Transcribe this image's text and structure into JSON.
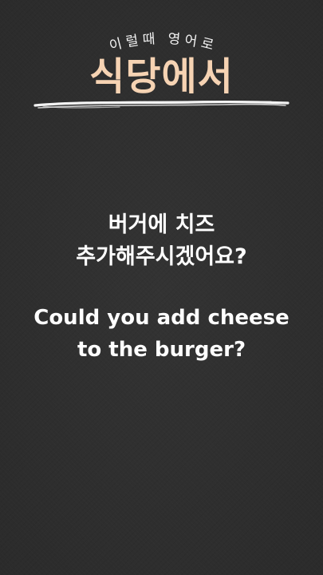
{
  "header": {
    "subtitle": "이럴때 영어로",
    "title": "식당에서"
  },
  "phrase": {
    "korean_line_1": "버거에 치즈",
    "korean_line_2": "추가해주시겠어요?",
    "english_line_1": "Could you add cheese",
    "english_line_2": "to the burger?"
  },
  "colors": {
    "background": "#2e2e2e",
    "title": "#f6d3b3",
    "text": "#ffffff"
  }
}
